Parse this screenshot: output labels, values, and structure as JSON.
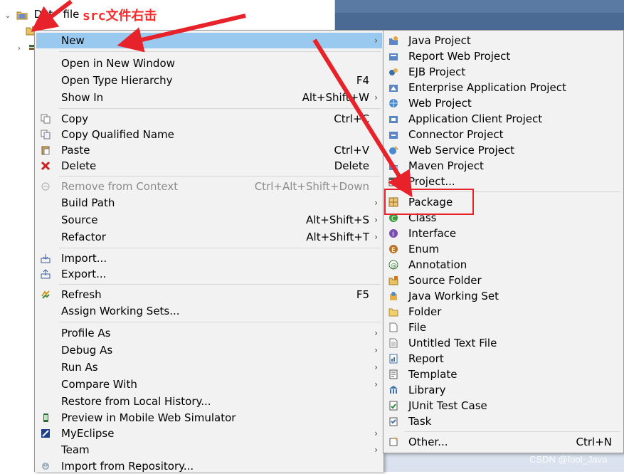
{
  "explorer": {
    "project_name": "Dat   file",
    "src_label": "src"
  },
  "annotation": "src文件右击",
  "watermark": "CSDN @fool_Java",
  "colors": {
    "highlight": "#99c9ef",
    "annotation": "#ff2a2a",
    "menu_bg": "#f2f2f2"
  },
  "context_menu": {
    "items": [
      {
        "label": "New",
        "arrow": "›",
        "icon": "none"
      },
      {
        "label": "Open in New Window"
      },
      {
        "label": "Open Type Hierarchy",
        "shortcut": "F4"
      },
      {
        "label": "Show In",
        "shortcut": "Alt+Shift+W",
        "arrow": "›"
      },
      {
        "label": "Copy",
        "shortcut": "Ctrl+C",
        "icon": "copy-icon"
      },
      {
        "label": "Copy Qualified Name",
        "icon": "copy-qualified-icon"
      },
      {
        "label": "Paste",
        "shortcut": "Ctrl+V",
        "icon": "paste-icon"
      },
      {
        "label": "Delete",
        "shortcut": "Delete",
        "icon": "delete-icon"
      },
      {
        "label": "Remove from Context",
        "shortcut": "Ctrl+Alt+Shift+Down",
        "icon": "remove-context-icon"
      },
      {
        "label": "Build Path",
        "arrow": "›"
      },
      {
        "label": "Source",
        "shortcut": "Alt+Shift+S",
        "arrow": "›"
      },
      {
        "label": "Refactor",
        "shortcut": "Alt+Shift+T",
        "arrow": "›"
      },
      {
        "label": "Import...",
        "icon": "import-icon"
      },
      {
        "label": "Export...",
        "icon": "export-icon"
      },
      {
        "label": "Refresh",
        "shortcut": "F5",
        "icon": "refresh-icon"
      },
      {
        "label": "Assign Working Sets..."
      },
      {
        "label": "Profile As",
        "arrow": "›"
      },
      {
        "label": "Debug As",
        "arrow": "›"
      },
      {
        "label": "Run As",
        "arrow": "›"
      },
      {
        "label": "Compare With",
        "arrow": "›"
      },
      {
        "label": "Restore from Local History..."
      },
      {
        "label": "Preview in Mobile Web Simulator",
        "icon": "mobile-preview-icon"
      },
      {
        "label": "MyEclipse",
        "arrow": "›",
        "icon": "myeclipse-icon"
      },
      {
        "label": "Team",
        "arrow": "›"
      },
      {
        "label": "Import from Repository...",
        "icon": "repository-import-icon"
      }
    ]
  },
  "submenu": {
    "items": [
      {
        "label": "Java Project"
      },
      {
        "label": "Report Web Project"
      },
      {
        "label": "EJB Project"
      },
      {
        "label": "Enterprise Application Project"
      },
      {
        "label": "Web Project"
      },
      {
        "label": "Application Client Project"
      },
      {
        "label": "Connector Project"
      },
      {
        "label": "Web Service Project"
      },
      {
        "label": "Maven Project"
      },
      {
        "label": "Project..."
      },
      {
        "label": "Package"
      },
      {
        "label": "Class"
      },
      {
        "label": "Interface"
      },
      {
        "label": "Enum"
      },
      {
        "label": "Annotation"
      },
      {
        "label": "Source Folder"
      },
      {
        "label": "Java Working Set"
      },
      {
        "label": "Folder"
      },
      {
        "label": "File"
      },
      {
        "label": "Untitled Text File"
      },
      {
        "label": "Report"
      },
      {
        "label": "Template"
      },
      {
        "label": "Library"
      },
      {
        "label": "JUnit Test Case"
      },
      {
        "label": "Task"
      },
      {
        "label": "Other...",
        "shortcut": "Ctrl+N"
      }
    ]
  }
}
